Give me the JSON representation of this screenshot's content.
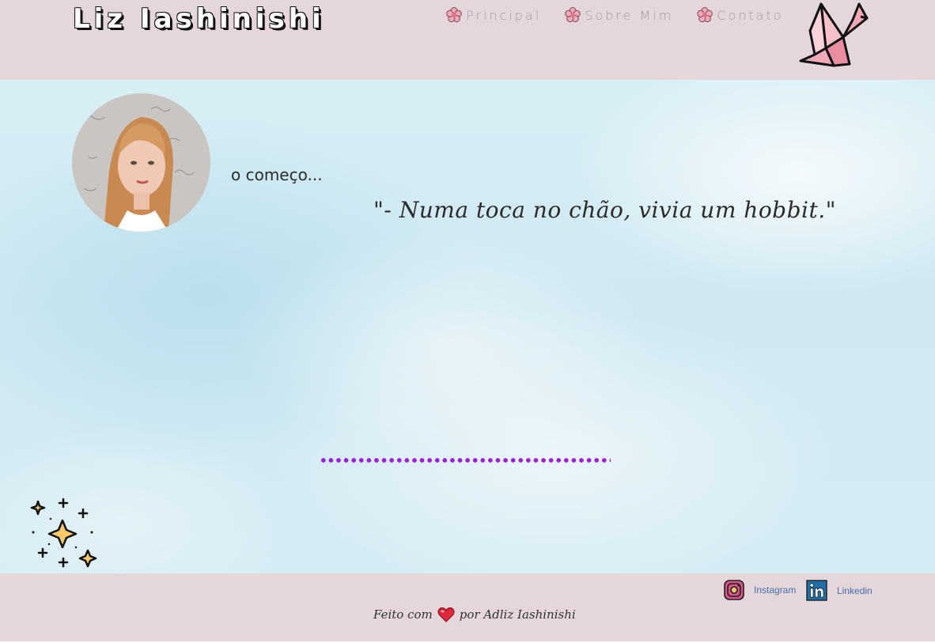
{
  "header": {
    "site_title": "Liz Iashinishi",
    "nav": [
      {
        "label": "Principal",
        "icon": "flower-icon"
      },
      {
        "label": "Sobre Mim",
        "icon": "flower-icon"
      },
      {
        "label": "Contato",
        "icon": "flower-icon"
      }
    ],
    "logo_icon": "origami-crane-icon"
  },
  "main": {
    "section_heading": "o começo...",
    "quote": "\"- Numa toca no chão, vivia um hobbit.\"",
    "divider_color": "#9a1ed4",
    "decoration_icon": "sparkles-icon"
  },
  "footer": {
    "social": [
      {
        "label": "Instagram",
        "icon": "instagram-icon"
      },
      {
        "label": "Linkedin",
        "icon": "linkedin-icon"
      }
    ],
    "credits_before": "Feito com",
    "credits_after": "por Adliz Iashinishi",
    "heart_icon": "heart-icon"
  },
  "colors": {
    "header_bg": "#e5d6db",
    "footer_bg": "#e5d6db",
    "accent_pink": "#f2a9b7",
    "link_blue": "#4a6ea9"
  }
}
